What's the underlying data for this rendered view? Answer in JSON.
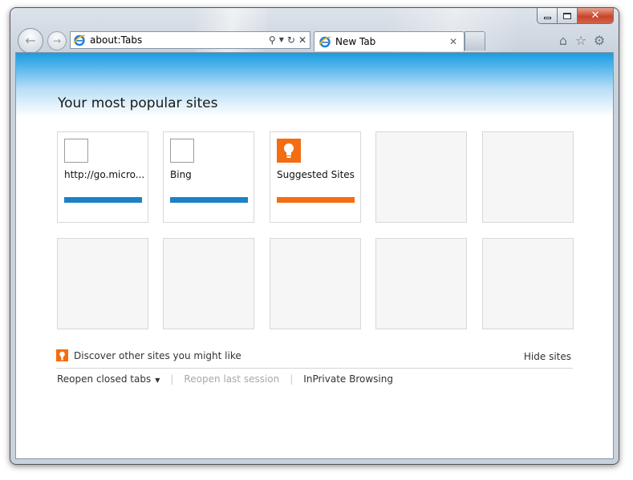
{
  "window": {
    "caption": {
      "minimize": "–",
      "maximize": "",
      "close": "✕"
    }
  },
  "address_bar": {
    "url": "about:Tabs"
  },
  "tabs": [
    {
      "label": "New Tab"
    }
  ],
  "toolbar": {
    "home_icon": "home-icon",
    "favorites_icon": "star-icon",
    "tools_icon": "gear-icon"
  },
  "page": {
    "heading": "Your most popular sites",
    "tiles_row1": [
      {
        "label": "http://go.micro...",
        "bar_color": "#1b82c5",
        "icon": "blank-favicon"
      },
      {
        "label": "Bing",
        "bar_color": "#1b82c5",
        "icon": "blank-favicon"
      },
      {
        "label": "Suggested Sites",
        "bar_color": "#f36d12",
        "icon": "suggested-sites-icon"
      }
    ],
    "discover_text": "Discover other sites you might like",
    "hide_sites": "Hide sites",
    "links": {
      "reopen_closed_tabs": "Reopen closed tabs",
      "reopen_last_session": "Reopen last session",
      "inprivate": "InPrivate Browsing"
    }
  },
  "colors": {
    "accent_blue": "#1b82c5",
    "accent_orange": "#f36d12",
    "hero_blue": "#1b9be0"
  }
}
